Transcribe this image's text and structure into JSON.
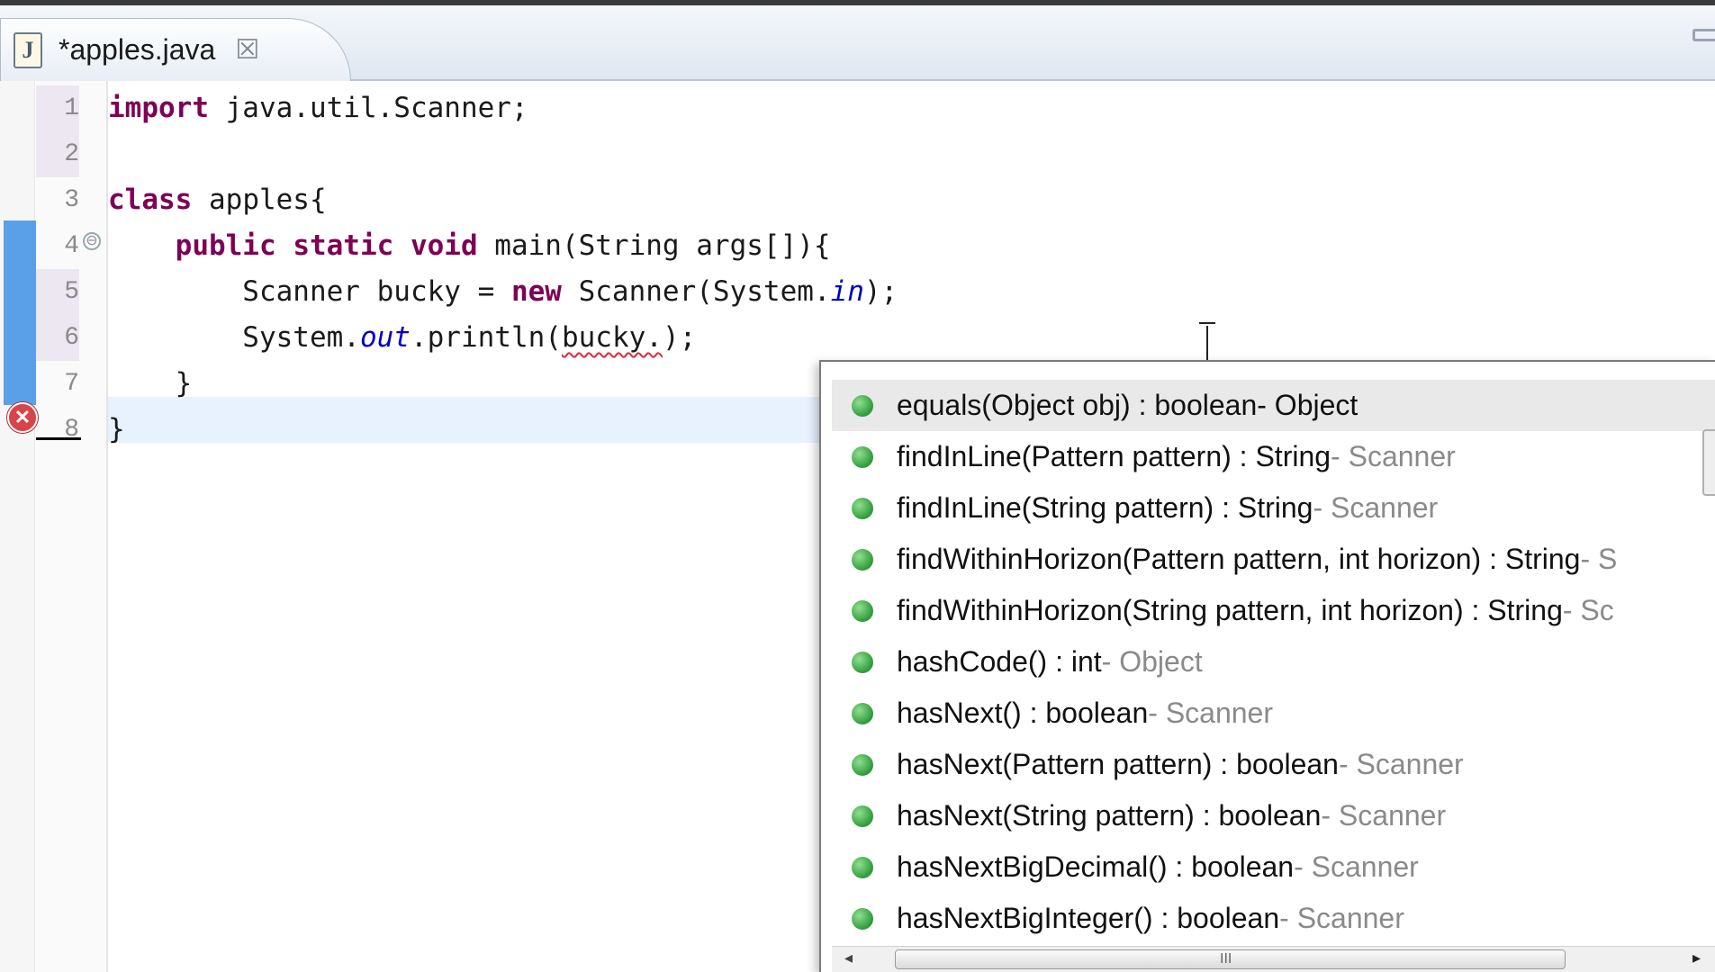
{
  "tab": {
    "title": "*apples.java",
    "file_icon": "J",
    "close_icon": "☒"
  },
  "editor": {
    "line_numbers": [
      "1",
      "2",
      "3",
      "4",
      "5",
      "6",
      "7",
      "8"
    ],
    "lines": [
      {
        "segments": [
          {
            "t": "import",
            "c": "kw"
          },
          {
            "t": " java.util.Scanner;",
            "c": ""
          }
        ]
      },
      {
        "segments": []
      },
      {
        "segments": [
          {
            "t": "class",
            "c": "kw"
          },
          {
            "t": " apples{",
            "c": ""
          }
        ]
      },
      {
        "segments": [
          {
            "t": "    ",
            "c": ""
          },
          {
            "t": "public",
            "c": "kw"
          },
          {
            "t": " ",
            "c": ""
          },
          {
            "t": "static",
            "c": "kw"
          },
          {
            "t": " ",
            "c": ""
          },
          {
            "t": "void",
            "c": "kw"
          },
          {
            "t": " main(String args[]){",
            "c": ""
          }
        ]
      },
      {
        "segments": [
          {
            "t": "        Scanner bucky = ",
            "c": ""
          },
          {
            "t": "new",
            "c": "kw"
          },
          {
            "t": " Scanner(System.",
            "c": ""
          },
          {
            "t": "in",
            "c": "fld"
          },
          {
            "t": ");",
            "c": ""
          }
        ]
      },
      {
        "segments": [
          {
            "t": "        System.",
            "c": ""
          },
          {
            "t": "out",
            "c": "fld"
          },
          {
            "t": ".println(",
            "c": ""
          },
          {
            "t": "bucky.",
            "c": "err"
          },
          {
            "t": ");",
            "c": ""
          }
        ]
      },
      {
        "segments": [
          {
            "t": "    }",
            "c": ""
          }
        ]
      },
      {
        "segments": [
          {
            "t": "}",
            "c": ""
          }
        ]
      }
    ],
    "error_marker": "✕",
    "fold_marker": "⊖"
  },
  "content_assist": {
    "proposals": [
      {
        "signature": "equals(Object obj) : boolean",
        "owner": "Object",
        "selected": true
      },
      {
        "signature": "findInLine(Pattern pattern) : String",
        "owner": "Scanner",
        "selected": false
      },
      {
        "signature": "findInLine(String pattern) : String",
        "owner": "Scanner",
        "selected": false
      },
      {
        "signature": "findWithinHorizon(Pattern pattern, int horizon) : String",
        "owner": "S",
        "selected": false
      },
      {
        "signature": "findWithinHorizon(String pattern, int horizon) : String",
        "owner": "Sc",
        "selected": false
      },
      {
        "signature": "hashCode() : int",
        "owner": "Object",
        "selected": false
      },
      {
        "signature": "hasNext() : boolean",
        "owner": "Scanner",
        "selected": false
      },
      {
        "signature": "hasNext(Pattern pattern) : boolean",
        "owner": "Scanner",
        "selected": false
      },
      {
        "signature": "hasNext(String pattern) : boolean",
        "owner": "Scanner",
        "selected": false
      },
      {
        "signature": "hasNextBigDecimal() : boolean",
        "owner": "Scanner",
        "selected": false
      },
      {
        "signature": "hasNextBigInteger() : boolean",
        "owner": "Scanner",
        "selected": false
      }
    ],
    "scroll_left": "◂",
    "scroll_right": "▸",
    "scroll_grip": "III"
  },
  "colors": {
    "keyword": "#7f0055",
    "field": "#0000c0",
    "method_icon": "#2f9a3a",
    "error": "#d9434a",
    "current_line": "#e8f2fe"
  },
  "icons": [
    "java-file-icon",
    "close-icon",
    "error-icon",
    "fold-icon",
    "method-icon",
    "text-cursor-icon",
    "restore-icon"
  ]
}
